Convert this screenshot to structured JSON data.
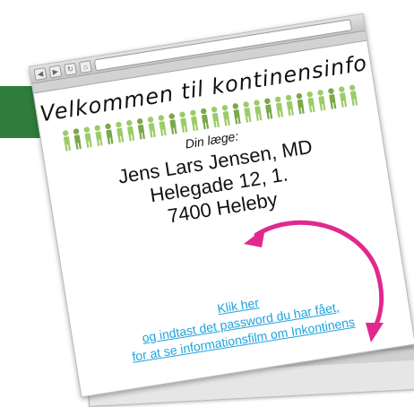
{
  "welcome": {
    "title": "Velkommen til kontinensinfo"
  },
  "doctor": {
    "label": "Din læge:",
    "name": "Jens Lars Jensen, MD",
    "street": "Helegade 12, 1.",
    "city": "7400 Heleby"
  },
  "links": {
    "click": "Klik her",
    "line2": "og indtast det password du har fået,",
    "line3": "for at se informationsfilm om Inkontinens"
  },
  "colors": {
    "accent_green": "#2e7d3a",
    "arrow_magenta": "#e0288f",
    "link_blue": "#1ea3dc",
    "figure_green": "#8fc25a"
  },
  "icons": [
    "back-icon",
    "forward-icon",
    "reload-icon",
    "home-icon",
    "gear-icon",
    "arrow-icon"
  ]
}
